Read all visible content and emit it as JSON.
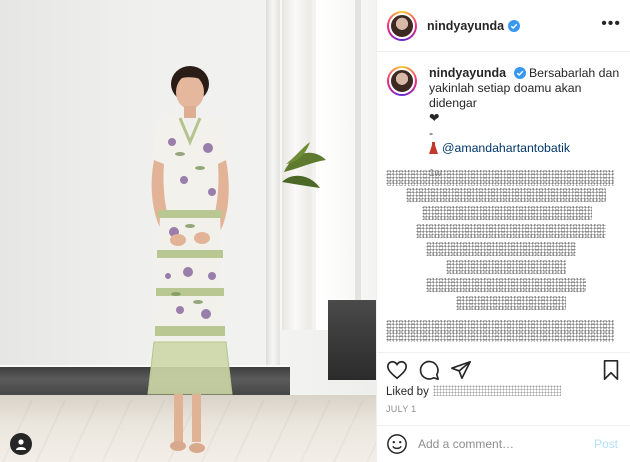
{
  "post": {
    "username": "nindyayunda",
    "verified": true,
    "more_label": "•••"
  },
  "caption": {
    "username": "nindyayunda",
    "text_line1": "Bersabarlah dan",
    "text_line2": "yakinlah setiap doamu akan didengar",
    "heart": "❤",
    "dash": "-",
    "dress_icon": "dress-icon",
    "mention": "@amandahartantobatik",
    "time": "1w"
  },
  "engagement": {
    "liked_by_label": "Liked by",
    "date": "JULY 1"
  },
  "icons": {
    "like": "heart-icon",
    "comment": "comment-icon",
    "share": "paper-plane-icon",
    "save": "bookmark-icon",
    "tag": "user-tag-icon",
    "emoji": "emoji-icon"
  },
  "comment_box": {
    "placeholder": "Add a comment…",
    "post_label": "Post"
  },
  "colors": {
    "verified": "#3897f0",
    "link": "#00376b",
    "muted": "#8e8e8e",
    "post_disabled": "#b2dffc"
  }
}
